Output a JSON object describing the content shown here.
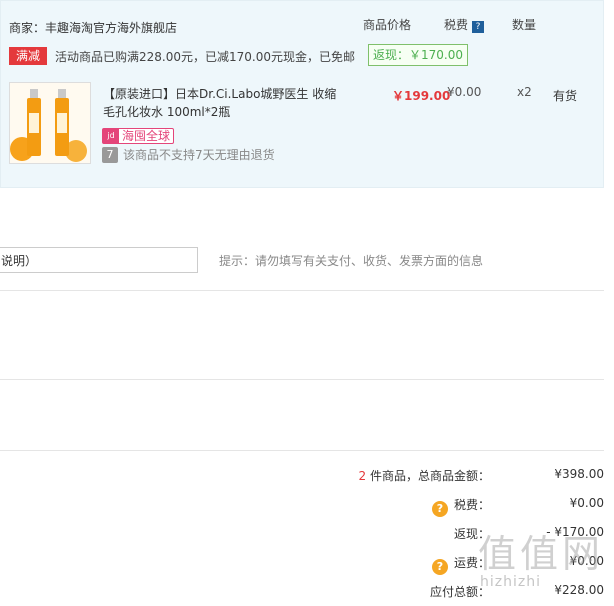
{
  "order": {
    "merchant": "商家：丰趣海淘官方海外旗舰店",
    "columns": {
      "price": "商品价格",
      "tax": "税费",
      "tax_help": "?",
      "qty": "数量"
    },
    "promotion": {
      "tag": "满减",
      "text": "活动商品已购满228.00元，已减170.00元现金，已免邮",
      "rebate": "返现：￥170.00"
    },
    "item": {
      "name": "【原装进口】日本Dr.Ci.Labo城野医生 收缩毛孔化妆水 100ml*2瓶",
      "price": "￥199.00",
      "tax": "¥0.00",
      "qty": "x2",
      "stock": "有货",
      "global_badge": "海囤全球",
      "global_icon": "jd",
      "no_return_icon": "7",
      "no_return_text": "该商品不支持7天无理由退货"
    }
  },
  "message": {
    "value": "说明）",
    "hint": "提示：请勿填写有关支付、收货、发票方面的信息"
  },
  "summary": {
    "count": "2",
    "count_label": " 件商品，总商品金额：",
    "total": "¥398.00",
    "tax_label": "税费：",
    "tax": "¥0.00",
    "rebate_label": "返现：",
    "rebate": "- ¥170.00",
    "shipping_label": "运费：",
    "shipping": "¥0.00",
    "payable_label": "应付总额：",
    "payable": "¥228.00"
  },
  "watermark": {
    "main": "值值网",
    "sub": "hizhizhi"
  },
  "colors": {
    "accent_red": "#e4393c",
    "green": "#4caf50",
    "pink": "#e4457a",
    "panel_bg": "#eef7fb"
  }
}
